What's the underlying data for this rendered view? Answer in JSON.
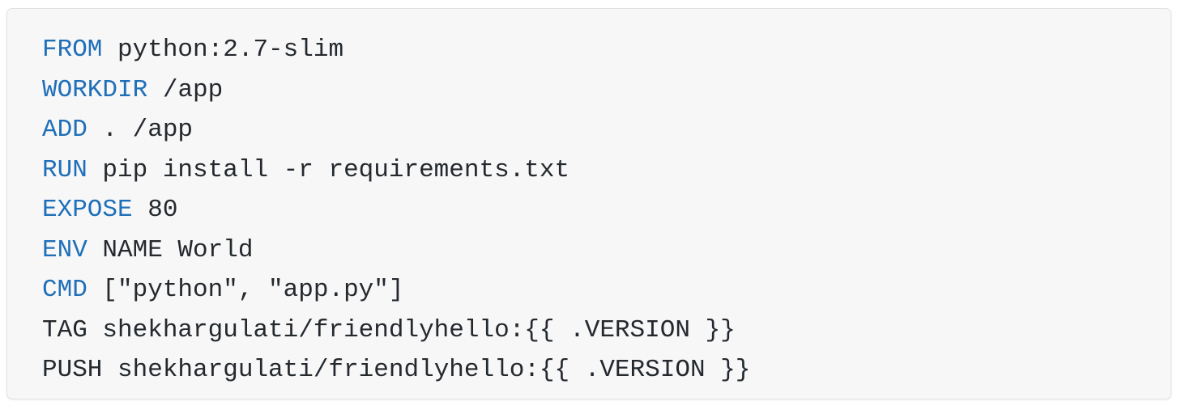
{
  "code_block": {
    "language": "dockerfile",
    "colors": {
      "keyword": "#1f6fb8",
      "text": "#24292e",
      "background": "#f7f7f8",
      "border": "#e2e2e4",
      "page_background": "#ffffff"
    },
    "lines": [
      {
        "keyword": "FROM",
        "highlighted": true,
        "rest": " python:2.7-slim"
      },
      {
        "keyword": "WORKDIR",
        "highlighted": true,
        "rest": " /app"
      },
      {
        "keyword": "ADD",
        "highlighted": true,
        "rest": " . /app"
      },
      {
        "keyword": "RUN",
        "highlighted": true,
        "rest": " pip install -r requirements.txt"
      },
      {
        "keyword": "EXPOSE",
        "highlighted": true,
        "rest": " 80"
      },
      {
        "keyword": "ENV",
        "highlighted": true,
        "rest": " NAME World"
      },
      {
        "keyword": "CMD",
        "highlighted": true,
        "rest": " [\"python\", \"app.py\"]"
      },
      {
        "keyword": "TAG",
        "highlighted": false,
        "rest": " shekhargulati/friendlyhello:{{ .VERSION }}"
      },
      {
        "keyword": "PUSH",
        "highlighted": false,
        "rest": " shekhargulati/friendlyhello:{{ .VERSION }}"
      }
    ],
    "full_text": "FROM python:2.7-slim\nWORKDIR /app\nADD . /app\nRUN pip install -r requirements.txt\nEXPOSE 80\nENV NAME World\nCMD [\"python\", \"app.py\"]\nTAG shekhargulati/friendlyhello:{{ .VERSION }}\nPUSH shekhargulati/friendlyhello:{{ .VERSION }}"
  }
}
